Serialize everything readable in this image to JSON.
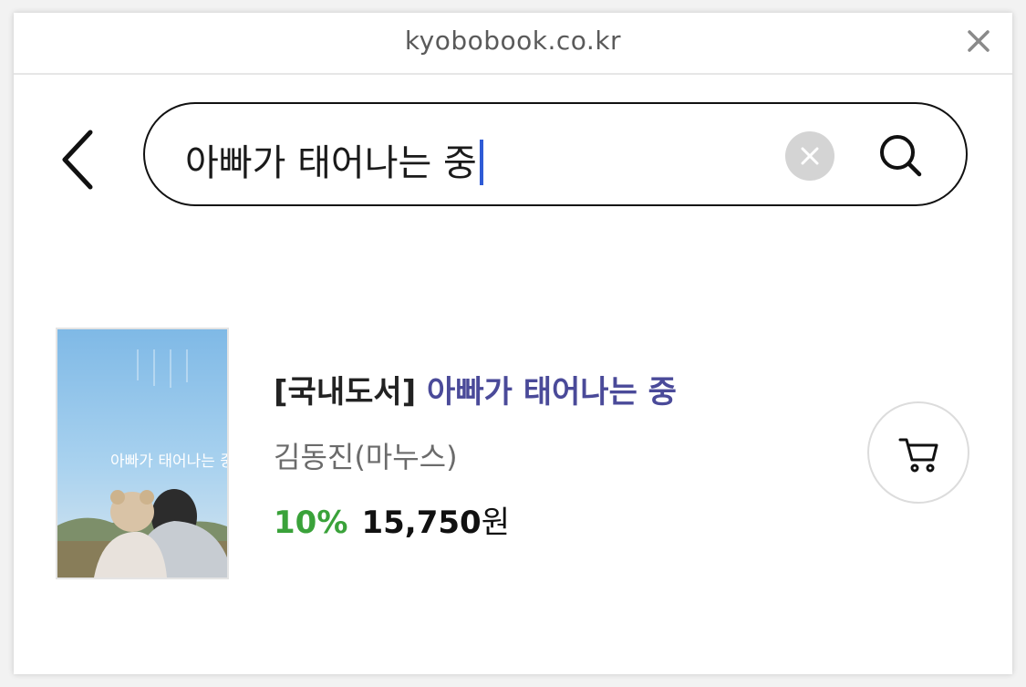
{
  "browser": {
    "url": "kyobobook.co.kr"
  },
  "search": {
    "query": "아빠가 태어나는 중"
  },
  "result": {
    "prefix": "[국내도서]",
    "title": "아빠가 태어나는 중",
    "author": "김동진(마누스)",
    "discount": "10%",
    "price": "15,750",
    "currency": "원",
    "cover_text": "아빠가 태어나는 중"
  },
  "colors": {
    "title": "#4a4a99",
    "discount": "#3aa23a",
    "caret": "#2f5bd6"
  },
  "icons": {
    "close": "close-icon",
    "back": "chevron-left-icon",
    "clear": "clear-circle-icon",
    "search": "search-icon",
    "cart": "cart-icon"
  }
}
